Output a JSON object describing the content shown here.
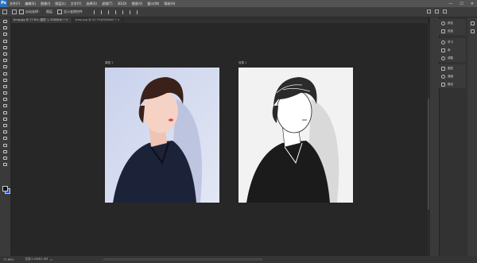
{
  "app": {
    "logo": "Ps"
  },
  "menu": {
    "items": [
      "文件(F)",
      "编辑(E)",
      "图像(I)",
      "图层(L)",
      "文字(Y)",
      "选择(S)",
      "滤镜(T)",
      "3D(D)",
      "视图(V)",
      "窗口(W)",
      "帮助(H)"
    ]
  },
  "window_controls": {
    "minimize": "—",
    "maximize": "☐",
    "close": "✕"
  },
  "options": {
    "auto_select": "自动选择：",
    "layer_select": "图层",
    "show_transform": "显示变换控件"
  },
  "tabs": [
    {
      "label": "timg.jpg @ 77.8% (图层 1, RGB/8#) *",
      "close": "×"
    },
    {
      "label": "ierop.jpg @ 42.7%(RGB/8#) *",
      "close": "×"
    }
  ],
  "images": {
    "left_label": "原图 1",
    "right_label": "效果 1"
  },
  "panels": {
    "group1": [
      {
        "label": "颜色",
        "icon": "color-icon"
      },
      {
        "label": "色板",
        "icon": "swatches-icon"
      }
    ],
    "group2": [
      {
        "label": "学习",
        "icon": "learn-icon"
      },
      {
        "label": "库",
        "icon": "libraries-icon"
      },
      {
        "label": "调整",
        "icon": "adjust-icon"
      }
    ],
    "group3": [
      {
        "label": "图层",
        "icon": "layers-icon"
      },
      {
        "label": "通道",
        "icon": "channels-icon"
      },
      {
        "label": "路径",
        "icon": "paths-icon"
      }
    ]
  },
  "status": {
    "zoom": "77.85%",
    "doc_size": "文档:1.04M/1.0M",
    "arrow": ">"
  },
  "colors": {
    "accent": "#2f6fb8",
    "fg_swatch": "#141414",
    "bg_swatch": "#2a5bd0"
  }
}
